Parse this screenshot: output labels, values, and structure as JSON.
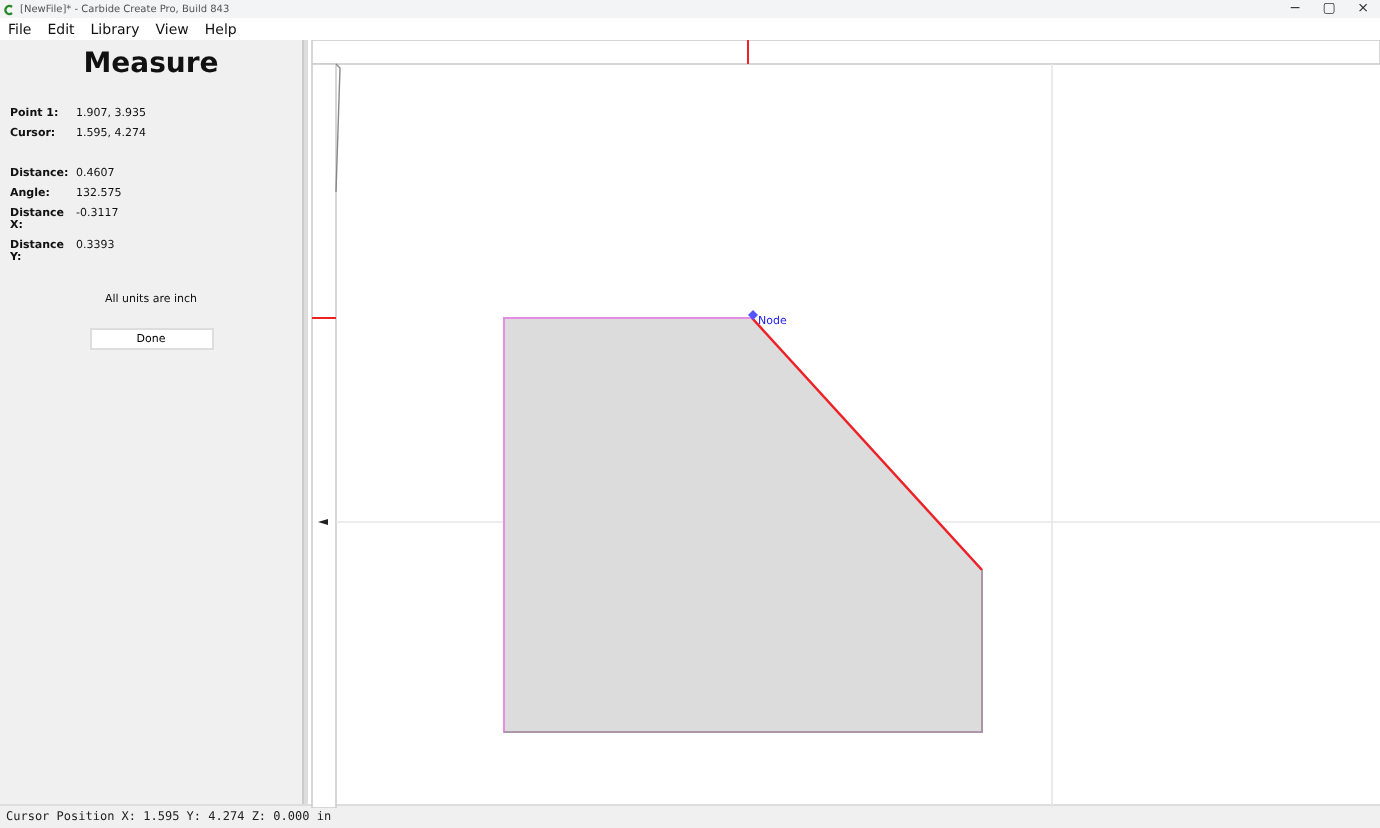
{
  "window": {
    "title": "[NewFile]* - Carbide Create Pro, Build 843",
    "controls": [
      "−",
      "▢",
      "×"
    ]
  },
  "menu": [
    "File",
    "Edit",
    "Library",
    "View",
    "Help"
  ],
  "measure": {
    "title": "Measure",
    "points": [
      {
        "label": "Point 1:",
        "value": "1.907, 3.935"
      },
      {
        "label": "Cursor:",
        "value": "1.595, 4.274"
      }
    ],
    "results": [
      {
        "label": "Distance:",
        "value": "0.4607"
      },
      {
        "label": "Angle:",
        "value": "132.575"
      },
      {
        "label": "Distance X:",
        "value": "-0.3117"
      },
      {
        "label": "Distance Y:",
        "value": "0.3393"
      }
    ],
    "note": "All units are inch",
    "button": "Done"
  },
  "canvas": {
    "node_label": "Node"
  },
  "status_bar": "Cursor Position X: 1.595 Y: 4.274 Z: 0.000 in"
}
